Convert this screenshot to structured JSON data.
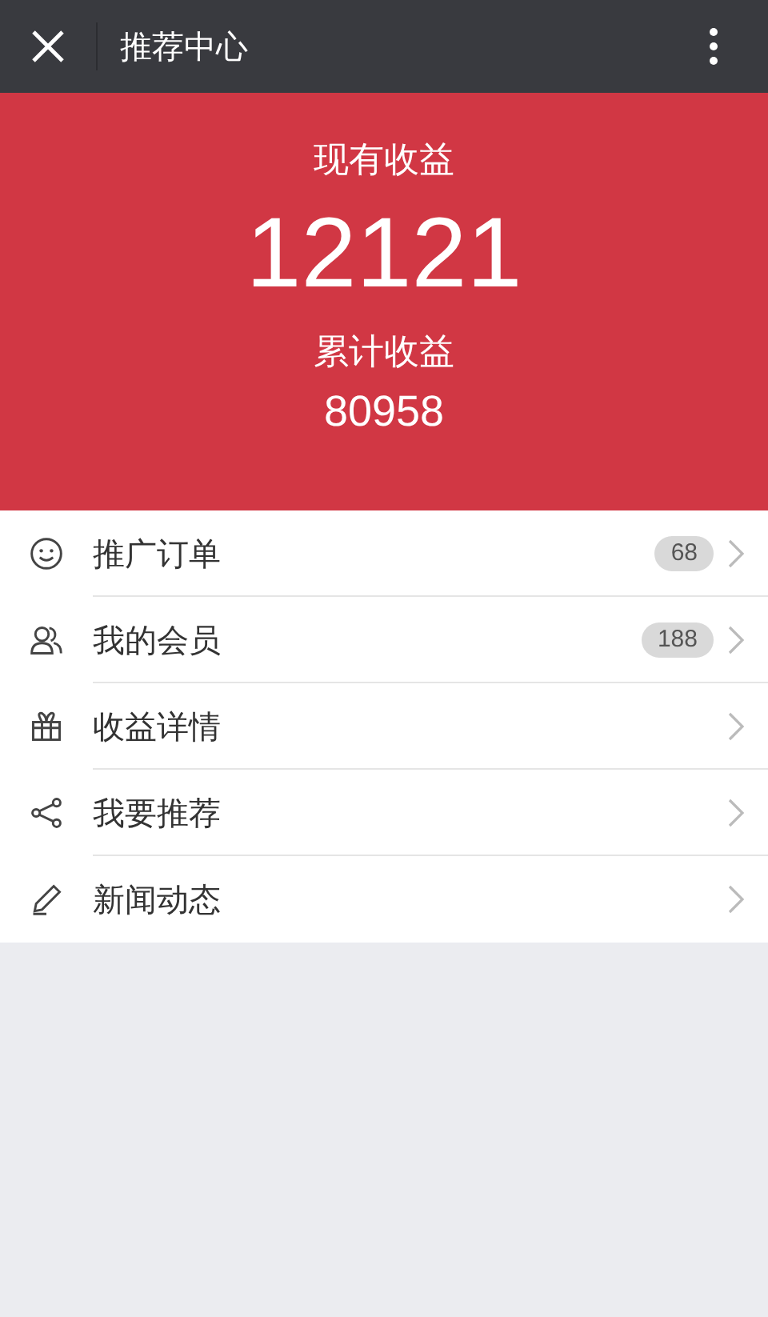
{
  "header": {
    "title": "推荐中心"
  },
  "earnings": {
    "current_label": "现有收益",
    "current_value": "12121",
    "total_label": "累计收益",
    "total_value": "80958"
  },
  "menu": [
    {
      "kind": "smile",
      "label": "推广订单",
      "badge": "68"
    },
    {
      "kind": "people",
      "label": "我的会员",
      "badge": "188"
    },
    {
      "kind": "gift",
      "label": "收益详情"
    },
    {
      "kind": "share",
      "label": "我要推荐"
    },
    {
      "kind": "pen",
      "label": "新闻动态"
    }
  ]
}
